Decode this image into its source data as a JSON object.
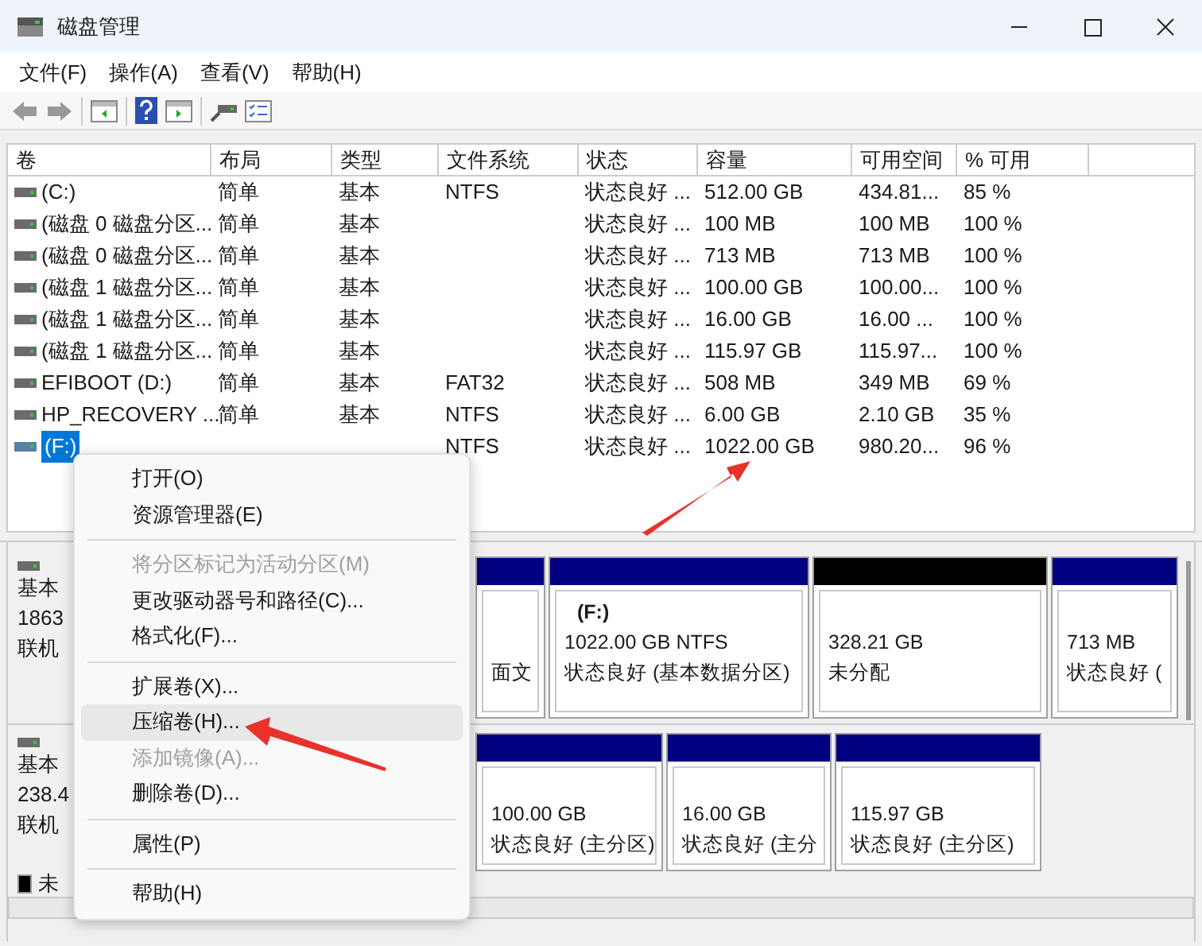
{
  "window": {
    "title": "磁盘管理"
  },
  "menubar": [
    "文件(F)",
    "操作(A)",
    "查看(V)",
    "帮助(H)"
  ],
  "table": {
    "columns": [
      "卷",
      "布局",
      "类型",
      "文件系统",
      "状态",
      "容量",
      "可用空间",
      "% 可用"
    ],
    "rows": [
      {
        "cells": [
          "(C:)",
          "简单",
          "基本",
          "NTFS",
          "状态良好 ...",
          "512.00 GB",
          "434.81...",
          "85 %"
        ],
        "selected": false
      },
      {
        "cells": [
          "(磁盘 0 磁盘分区...",
          "简单",
          "基本",
          "",
          "状态良好 ...",
          "100 MB",
          "100 MB",
          "100 %"
        ],
        "selected": false
      },
      {
        "cells": [
          "(磁盘 0 磁盘分区...",
          "简单",
          "基本",
          "",
          "状态良好 ...",
          "713 MB",
          "713 MB",
          "100 %"
        ],
        "selected": false
      },
      {
        "cells": [
          "(磁盘 1 磁盘分区...",
          "简单",
          "基本",
          "",
          "状态良好 ...",
          "100.00 GB",
          "100.00...",
          "100 %"
        ],
        "selected": false
      },
      {
        "cells": [
          "(磁盘 1 磁盘分区...",
          "简单",
          "基本",
          "",
          "状态良好 ...",
          "16.00 GB",
          "16.00 ...",
          "100 %"
        ],
        "selected": false
      },
      {
        "cells": [
          "(磁盘 1 磁盘分区...",
          "简单",
          "基本",
          "",
          "状态良好 ...",
          "115.97 GB",
          "115.97...",
          "100 %"
        ],
        "selected": false
      },
      {
        "cells": [
          "EFIBOOT (D:)",
          "简单",
          "基本",
          "FAT32",
          "状态良好 ...",
          "508 MB",
          "349 MB",
          "69 %"
        ],
        "selected": false
      },
      {
        "cells": [
          "HP_RECOVERY ...",
          "简单",
          "基本",
          "NTFS",
          "状态良好 ...",
          "6.00 GB",
          "2.10 GB",
          "35 %"
        ],
        "selected": false
      },
      {
        "cells": [
          "(F:)",
          "",
          "",
          "NTFS",
          "状态良好 ...",
          "1022.00 GB",
          "980.20...",
          "96 %"
        ],
        "selected": true
      }
    ]
  },
  "disks": [
    {
      "info": [
        "基本",
        "1863",
        "联机"
      ],
      "partitions": [
        {
          "kind": "allocated",
          "lines": [
            "面文"
          ]
        },
        {
          "kind": "allocated",
          "label": "(F:)",
          "lines": [
            "1022.00 GB NTFS",
            "状态良好 (基本数据分区)"
          ]
        },
        {
          "kind": "unallocated",
          "lines": [
            "328.21 GB",
            "未分配"
          ]
        },
        {
          "kind": "allocated",
          "lines": [
            "713 MB",
            "状态良好 ("
          ]
        }
      ]
    },
    {
      "info": [
        "基本",
        "238.4",
        "联机"
      ],
      "partitions": [
        {
          "kind": "allocated",
          "lines": [
            "100.00 GB",
            "状态良好 (主分区)"
          ]
        },
        {
          "kind": "allocated",
          "lines": [
            "16.00 GB",
            "状态良好 (主分"
          ]
        },
        {
          "kind": "allocated",
          "lines": [
            "115.97 GB",
            "状态良好 (主分区)"
          ]
        }
      ]
    }
  ],
  "legend": [
    {
      "label": "未",
      "color": "#000000"
    }
  ],
  "context_menu": [
    {
      "kind": "item",
      "label": "打开(O)",
      "disabled": false,
      "selected": false
    },
    {
      "kind": "item",
      "label": "资源管理器(E)",
      "disabled": false,
      "selected": false
    },
    {
      "kind": "separator"
    },
    {
      "kind": "item",
      "label": "将分区标记为活动分区(M)",
      "disabled": true,
      "selected": false
    },
    {
      "kind": "item",
      "label": "更改驱动器号和路径(C)...",
      "disabled": false,
      "selected": false
    },
    {
      "kind": "item",
      "label": "格式化(F)...",
      "disabled": false,
      "selected": false
    },
    {
      "kind": "separator"
    },
    {
      "kind": "item",
      "label": "扩展卷(X)...",
      "disabled": false,
      "selected": false
    },
    {
      "kind": "item",
      "label": "压缩卷(H)...",
      "disabled": false,
      "selected": true
    },
    {
      "kind": "item",
      "label": "添加镜像(A)...",
      "disabled": true,
      "selected": false
    },
    {
      "kind": "item",
      "label": "删除卷(D)...",
      "disabled": false,
      "selected": false
    },
    {
      "kind": "separator"
    },
    {
      "kind": "item",
      "label": "属性(P)",
      "disabled": false,
      "selected": false
    },
    {
      "kind": "separator"
    },
    {
      "kind": "item",
      "label": "帮助(H)",
      "disabled": false,
      "selected": false
    }
  ]
}
